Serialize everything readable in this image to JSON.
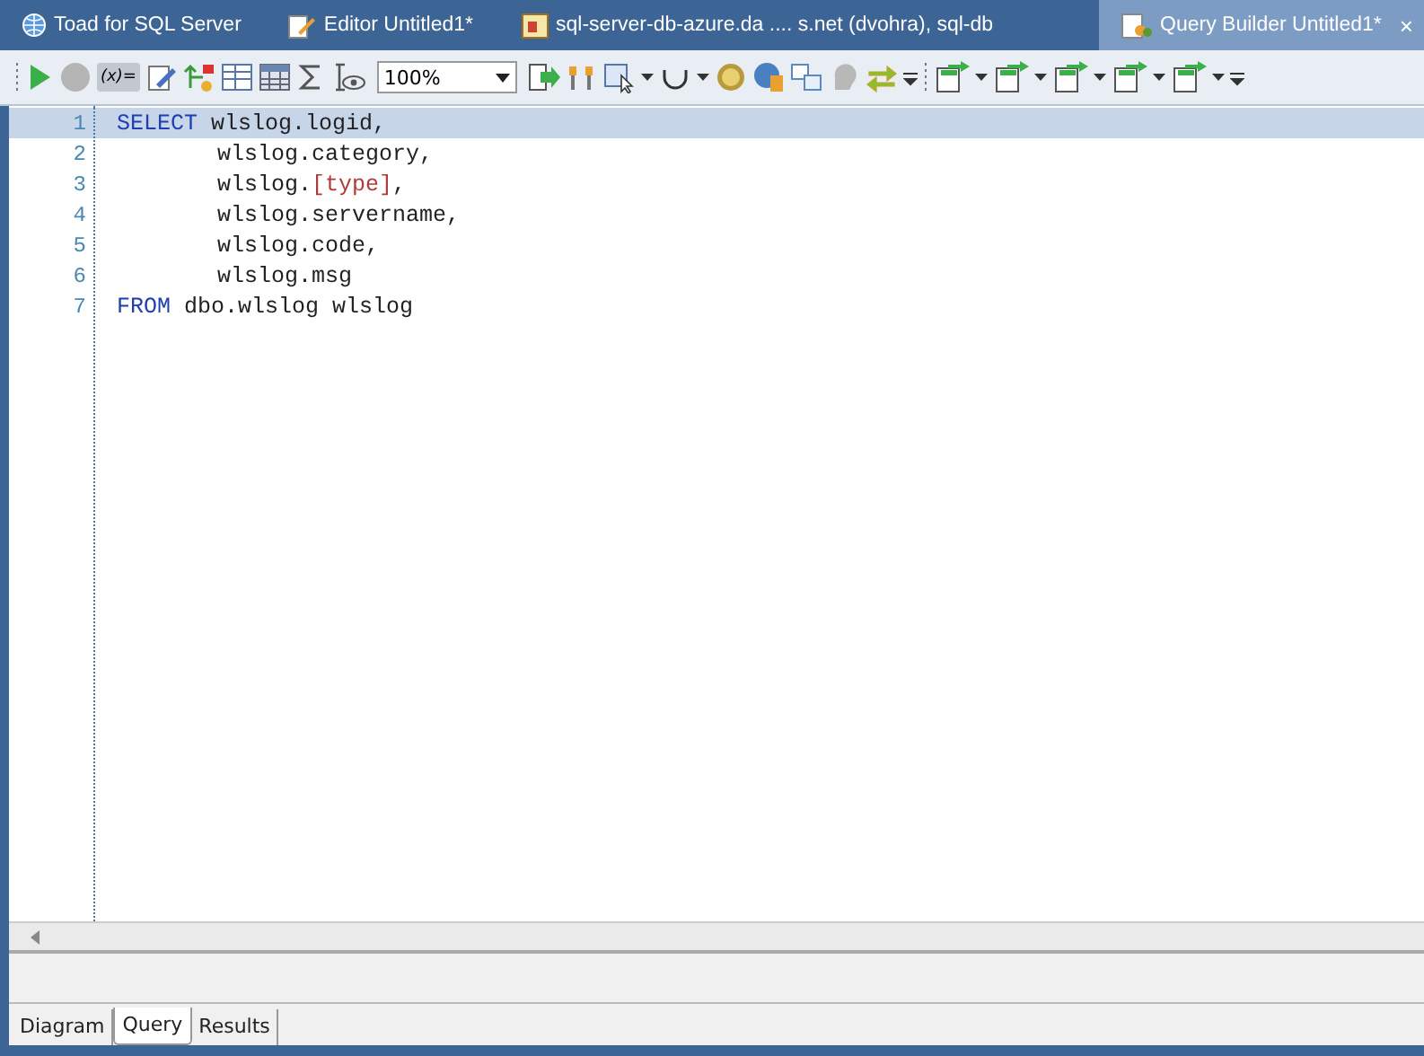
{
  "tabs": [
    {
      "label": "Toad for SQL Server",
      "selected": false
    },
    {
      "label": "Editor Untitled1*",
      "selected": false
    },
    {
      "label": "sql-server-db-azure.da .... s.net (dvohra), sql-db",
      "selected": false
    },
    {
      "label": "Query Builder Untitled1*",
      "selected": true,
      "close": "×"
    }
  ],
  "toolbar": {
    "variables_toggle": {
      "label": "(x)=",
      "selected": true
    },
    "zoom": "100%"
  },
  "editor": {
    "lines": [
      {
        "number": "1",
        "indented": false,
        "current": true,
        "tokens": [
          {
            "text": "SELECT",
            "kind": "keyword"
          },
          {
            "text": " wlslog.logid,",
            "kind": "plain"
          }
        ]
      },
      {
        "number": "2",
        "indented": true,
        "current": false,
        "tokens": [
          {
            "text": "wlslog.category,",
            "kind": "plain"
          }
        ]
      },
      {
        "number": "3",
        "indented": true,
        "current": false,
        "tokens": [
          {
            "text": "wlslog.",
            "kind": "plain"
          },
          {
            "text": "[type]",
            "kind": "bracket"
          },
          {
            "text": ",",
            "kind": "plain"
          }
        ]
      },
      {
        "number": "4",
        "indented": true,
        "current": false,
        "tokens": [
          {
            "text": "wlslog.servername,",
            "kind": "plain"
          }
        ]
      },
      {
        "number": "5",
        "indented": true,
        "current": false,
        "tokens": [
          {
            "text": "wlslog.code,",
            "kind": "plain"
          }
        ]
      },
      {
        "number": "6",
        "indented": true,
        "current": false,
        "tokens": [
          {
            "text": "wlslog.msg",
            "kind": "plain"
          }
        ]
      },
      {
        "number": "7",
        "indented": false,
        "current": false,
        "tokens": [
          {
            "text": "FROM",
            "kind": "keyword"
          },
          {
            "text": " dbo.wlslog wlslog",
            "kind": "plain"
          }
        ]
      }
    ]
  },
  "bottom_tabs": [
    {
      "label": "Diagram",
      "selected": false
    },
    {
      "label": "Query",
      "selected": true
    },
    {
      "label": "Results",
      "selected": false
    }
  ]
}
